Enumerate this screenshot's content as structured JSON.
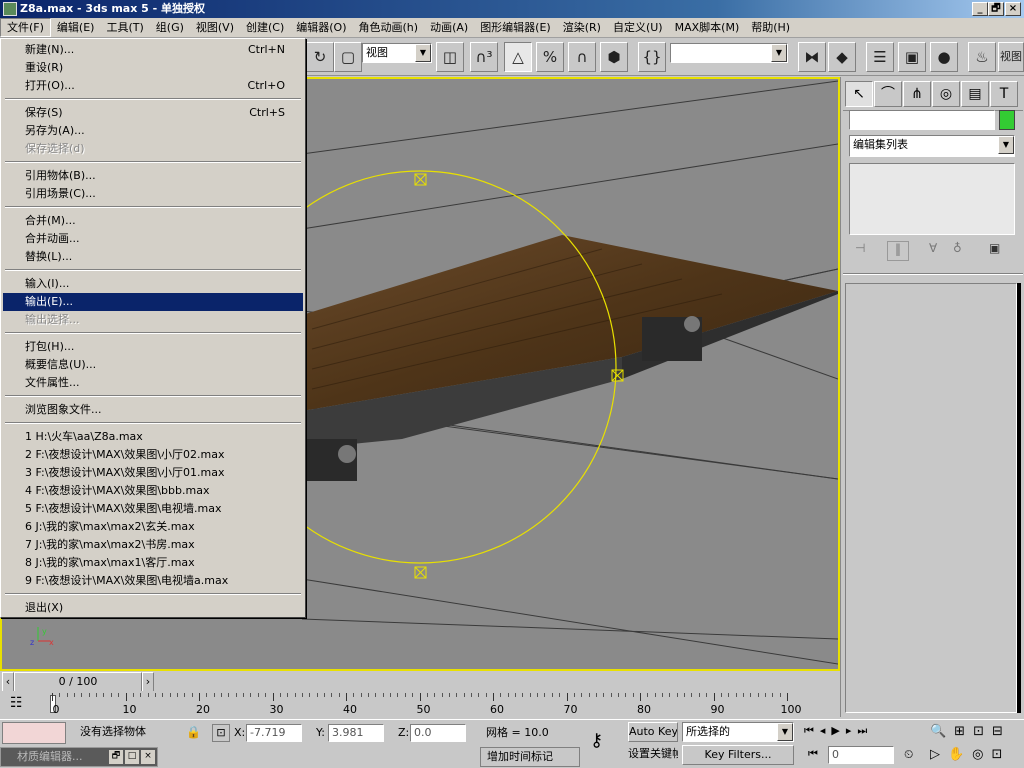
{
  "window": {
    "title": "Z8a.max - 3ds max 5 - 单独授权",
    "minimize": "_",
    "maximize": "🗗",
    "close": "×"
  },
  "menubar": [
    "文件(F)",
    "编辑(E)",
    "工具(T)",
    "组(G)",
    "视图(V)",
    "创建(C)",
    "编辑器(O)",
    "角色动画(h)",
    "动画(A)",
    "图形编辑器(E)",
    "渲染(R)",
    "自定义(U)",
    "MAX脚本(M)",
    "帮助(H)"
  ],
  "toolbar": {
    "view_combo": "视图",
    "selection_set_combo": "",
    "right_label": "视图",
    "icons": [
      "undo-icon",
      "select-region-icon",
      "viewport-select-icon",
      "select-filter-icon",
      "snap-3d-icon",
      "angle-snap-icon",
      "percent-snap-icon",
      "spinner-snap-icon",
      "edit-named-sel-icon",
      "mirror-icon",
      "align-icon",
      "track-view-icon",
      "schematic-icon",
      "material-editor-icon",
      "render-teapot-icon"
    ]
  },
  "file_menu": {
    "items": [
      {
        "label": "新建(N)...",
        "shortcut": "Ctrl+N",
        "state": "normal"
      },
      {
        "label": "重设(R)",
        "shortcut": "",
        "state": "normal"
      },
      {
        "label": "打开(O)...",
        "shortcut": "Ctrl+O",
        "state": "normal"
      },
      {
        "sep": true
      },
      {
        "label": "保存(S)",
        "shortcut": "Ctrl+S",
        "state": "normal"
      },
      {
        "label": "另存为(A)...",
        "shortcut": "",
        "state": "normal"
      },
      {
        "label": "保存选择(d)",
        "shortcut": "",
        "state": "disabled"
      },
      {
        "sep": true
      },
      {
        "label": "引用物体(B)...",
        "shortcut": "",
        "state": "normal"
      },
      {
        "label": "引用场景(C)...",
        "shortcut": "",
        "state": "normal"
      },
      {
        "sep": true
      },
      {
        "label": "合并(M)...",
        "shortcut": "",
        "state": "normal"
      },
      {
        "label": "合并动画...",
        "shortcut": "",
        "state": "normal"
      },
      {
        "label": "替换(L)...",
        "shortcut": "",
        "state": "normal"
      },
      {
        "sep": true
      },
      {
        "label": "输入(I)...",
        "shortcut": "",
        "state": "normal"
      },
      {
        "label": "输出(E)...",
        "shortcut": "",
        "state": "highlighted"
      },
      {
        "label": "输出选择...",
        "shortcut": "",
        "state": "disabled"
      },
      {
        "sep": true
      },
      {
        "label": "打包(H)...",
        "shortcut": "",
        "state": "normal"
      },
      {
        "label": "概要信息(U)...",
        "shortcut": "",
        "state": "normal"
      },
      {
        "label": "文件属性...",
        "shortcut": "",
        "state": "normal"
      },
      {
        "sep": true
      },
      {
        "label": "浏览图象文件...",
        "shortcut": "",
        "state": "normal"
      },
      {
        "sep": true
      },
      {
        "label": "1 H:\\火车\\aa\\Z8a.max",
        "shortcut": "",
        "state": "normal"
      },
      {
        "label": "2 F:\\夜想设计\\MAX\\效果图\\小厅02.max",
        "shortcut": "",
        "state": "normal"
      },
      {
        "label": "3 F:\\夜想设计\\MAX\\效果图\\小厅01.max",
        "shortcut": "",
        "state": "normal"
      },
      {
        "label": "4 F:\\夜想设计\\MAX\\效果图\\bbb.max",
        "shortcut": "",
        "state": "normal"
      },
      {
        "label": "5 F:\\夜想设计\\MAX\\效果图\\电视墙.max",
        "shortcut": "",
        "state": "normal"
      },
      {
        "label": "6 J:\\我的家\\max\\max2\\玄关.max",
        "shortcut": "",
        "state": "normal"
      },
      {
        "label": "7 J:\\我的家\\max\\max2\\书房.max",
        "shortcut": "",
        "state": "normal"
      },
      {
        "label": "8 J:\\我的家\\max\\max1\\客厅.max",
        "shortcut": "",
        "state": "normal"
      },
      {
        "label": "9 F:\\夜想设计\\MAX\\效果图\\电视墙a.max",
        "shortcut": "",
        "state": "normal"
      },
      {
        "sep": true
      },
      {
        "label": "退出(X)",
        "shortcut": "",
        "state": "normal"
      }
    ]
  },
  "command_panel": {
    "tabs": [
      "create-tab-icon",
      "modify-tab-icon",
      "hierarchy-tab-icon",
      "motion-tab-icon",
      "display-tab-icon",
      "utilities-tab-icon"
    ],
    "name_field": "",
    "color_swatch": "#33cc33",
    "modifier_list": "编辑集列表"
  },
  "timeline": {
    "frame_display": "0 / 100",
    "ticks": [
      "0",
      "10",
      "20",
      "30",
      "40",
      "50",
      "60",
      "70",
      "80",
      "90",
      "100"
    ]
  },
  "status": {
    "material_label": "材质编辑器...",
    "selection_text": "没有选择物体",
    "x_label": "X:",
    "x_value": "-7.719",
    "y_label": "Y:",
    "y_value": "3.981",
    "z_label": "Z:",
    "z_value": "0.0",
    "grid": "网格 = 10.0",
    "add_time_tag": "增加时间标记",
    "auto_key": "Auto Key",
    "set_key": "设置关键帧",
    "selected_combo": "所选择的",
    "key_filters": "Key Filters...",
    "frame_field": "0"
  },
  "colors": {
    "accent": "#0a246a",
    "viewport_border": "#e8e000",
    "gizmo": "#e8e000"
  }
}
